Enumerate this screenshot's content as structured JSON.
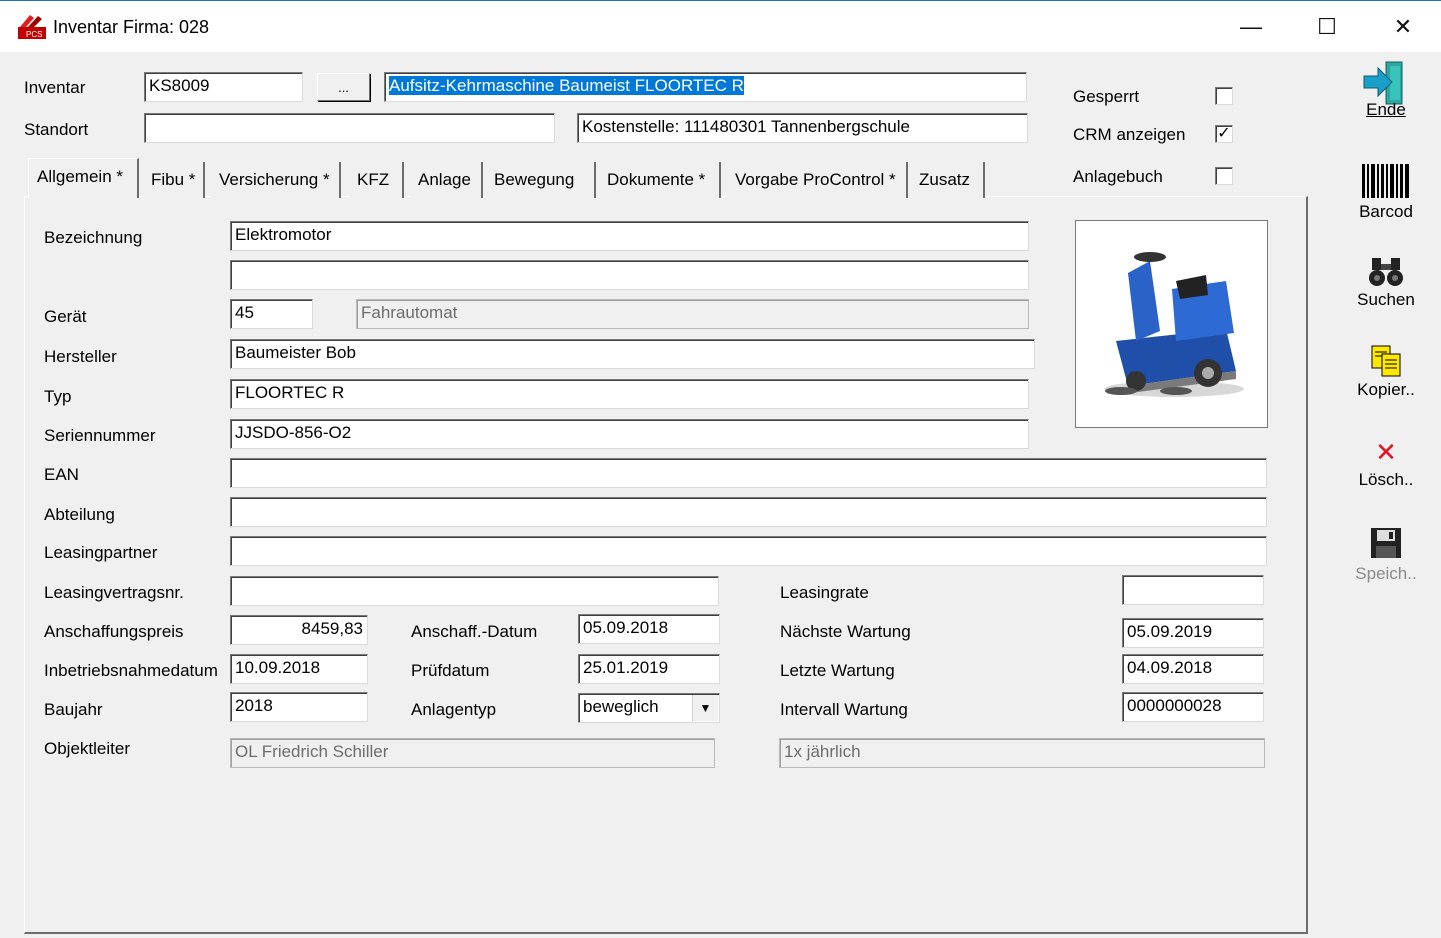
{
  "window": {
    "title": "Inventar Firma: 028",
    "minimize": "—",
    "maximize": "☐",
    "close": "✕"
  },
  "header": {
    "inventar_label": "Inventar",
    "inventar_value": "KS8009",
    "lookup_button": "...",
    "description_value": "Aufsitz-Kehrmaschine Baumeist FLOORTEC R",
    "standort_label": "Standort",
    "standort_value": "",
    "kostenstelle_value": "Kostenstelle: 111480301 Tannenbergschule",
    "gesperrt_label": "Gesperrt",
    "gesperrt_checked": "",
    "crm_label": "CRM anzeigen",
    "crm_checked": "✓",
    "anlagebuch_label": "Anlagebuch",
    "anlagebuch_checked": ""
  },
  "tabs": [
    {
      "label": "Allgemein *"
    },
    {
      "label": "Fibu *"
    },
    {
      "label": "Versicherung *"
    },
    {
      "label": "KFZ"
    },
    {
      "label": "Anlage"
    },
    {
      "label": "Bewegung"
    },
    {
      "label": "Dokumente *"
    },
    {
      "label": "Vorgabe ProControl *"
    },
    {
      "label": "Zusatz"
    }
  ],
  "form": {
    "bezeichnung_label": "Bezeichnung",
    "bezeichnung_value": "Elektromotor",
    "bezeichnung2_value": "",
    "geraet_label": "Gerät",
    "geraet_code": "45",
    "geraet_name": "Fahrautomat",
    "hersteller_label": "Hersteller",
    "hersteller_value": "Baumeister Bob",
    "typ_label": "Typ",
    "typ_value": "FLOORTEC R",
    "seriennummer_label": "Seriennummer",
    "seriennummer_value": "JJSDO-856-O2",
    "ean_label": "EAN",
    "ean_value": "",
    "abteilung_label": "Abteilung",
    "abteilung_value": "",
    "leasingpartner_label": "Leasingpartner",
    "leasingpartner_value": "",
    "leasingvertragsnr_label": "Leasingvertragsnr.",
    "leasingvertragsnr_value": "",
    "leasingrate_label": "Leasingrate",
    "leasingrate_value": "",
    "anschaffungspreis_label": "Anschaffungspreis",
    "anschaffungspreis_value": "8459,83",
    "anschaff_datum_label": "Anschaff.-Datum",
    "anschaff_datum_value": "05.09.2018",
    "naechste_wartung_label": "Nächste Wartung",
    "naechste_wartung_value": "05.09.2019",
    "inbetriebnahme_label": "Inbetriebsnahmedatum",
    "inbetriebnahme_value": "10.09.2018",
    "pruefdatum_label": "Prüfdatum",
    "pruefdatum_value": "25.01.2019",
    "letzte_wartung_label": "Letzte Wartung",
    "letzte_wartung_value": "04.09.2018",
    "baujahr_label": "Baujahr",
    "baujahr_value": "2018",
    "anlagentyp_label": "Anlagentyp",
    "anlagentyp_value": "beweglich",
    "intervall_label": "Intervall Wartung",
    "intervall_value": "0000000028",
    "objektleiter_label": "Objektleiter",
    "objektleiter_value": "OL Friedrich Schiller",
    "intervall_text": "1x jährlich"
  },
  "toolbar": [
    {
      "label": "Ende",
      "icon": "exit-door-icon"
    },
    {
      "label": "Barcod",
      "icon": "barcode-icon"
    },
    {
      "label": "Suchen",
      "icon": "binoculars-icon"
    },
    {
      "label": "Kopier..",
      "icon": "copy-icon"
    },
    {
      "label": "Lösch..",
      "icon": "delete-x-icon"
    },
    {
      "label": "Speich..",
      "icon": "floppy-disk-icon",
      "disabled": true
    }
  ],
  "colors": {
    "accent": "#0078d7",
    "delete_red": "#e81123",
    "window_bg": "#f0f0f0"
  }
}
